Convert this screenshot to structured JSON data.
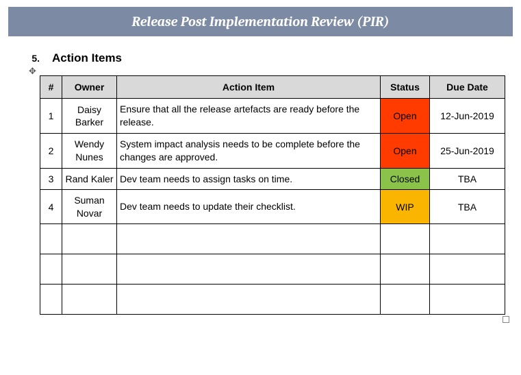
{
  "banner": {
    "title": "Release Post Implementation Review (PIR)"
  },
  "section": {
    "number": "5.",
    "title": "Action Items"
  },
  "table": {
    "headers": {
      "num": "#",
      "owner": "Owner",
      "action": "Action Item",
      "status": "Status",
      "due": "Due Date"
    },
    "rows": [
      {
        "num": "1",
        "owner": "Daisy Barker",
        "action": "Ensure that all the release artefacts are ready before the release.",
        "status": "Open",
        "status_color": "#ff3b00",
        "due": "12-Jun-2019"
      },
      {
        "num": "2",
        "owner": "Wendy Nunes",
        "action": "System impact analysis needs to be complete before the changes are approved.",
        "status": "Open",
        "status_color": "#ff3b00",
        "due": "25-Jun-2019"
      },
      {
        "num": "3",
        "owner": "Rand Kaler",
        "action": "Dev team needs to assign tasks on time.",
        "status": "Closed",
        "status_color": "#8bc34a",
        "due": "TBA"
      },
      {
        "num": "4",
        "owner": "Suman Novar",
        "action": "Dev team needs to update their checklist.",
        "status": "WIP",
        "status_color": "#f9b500",
        "due": "TBA"
      }
    ],
    "empty_rows": 3
  }
}
